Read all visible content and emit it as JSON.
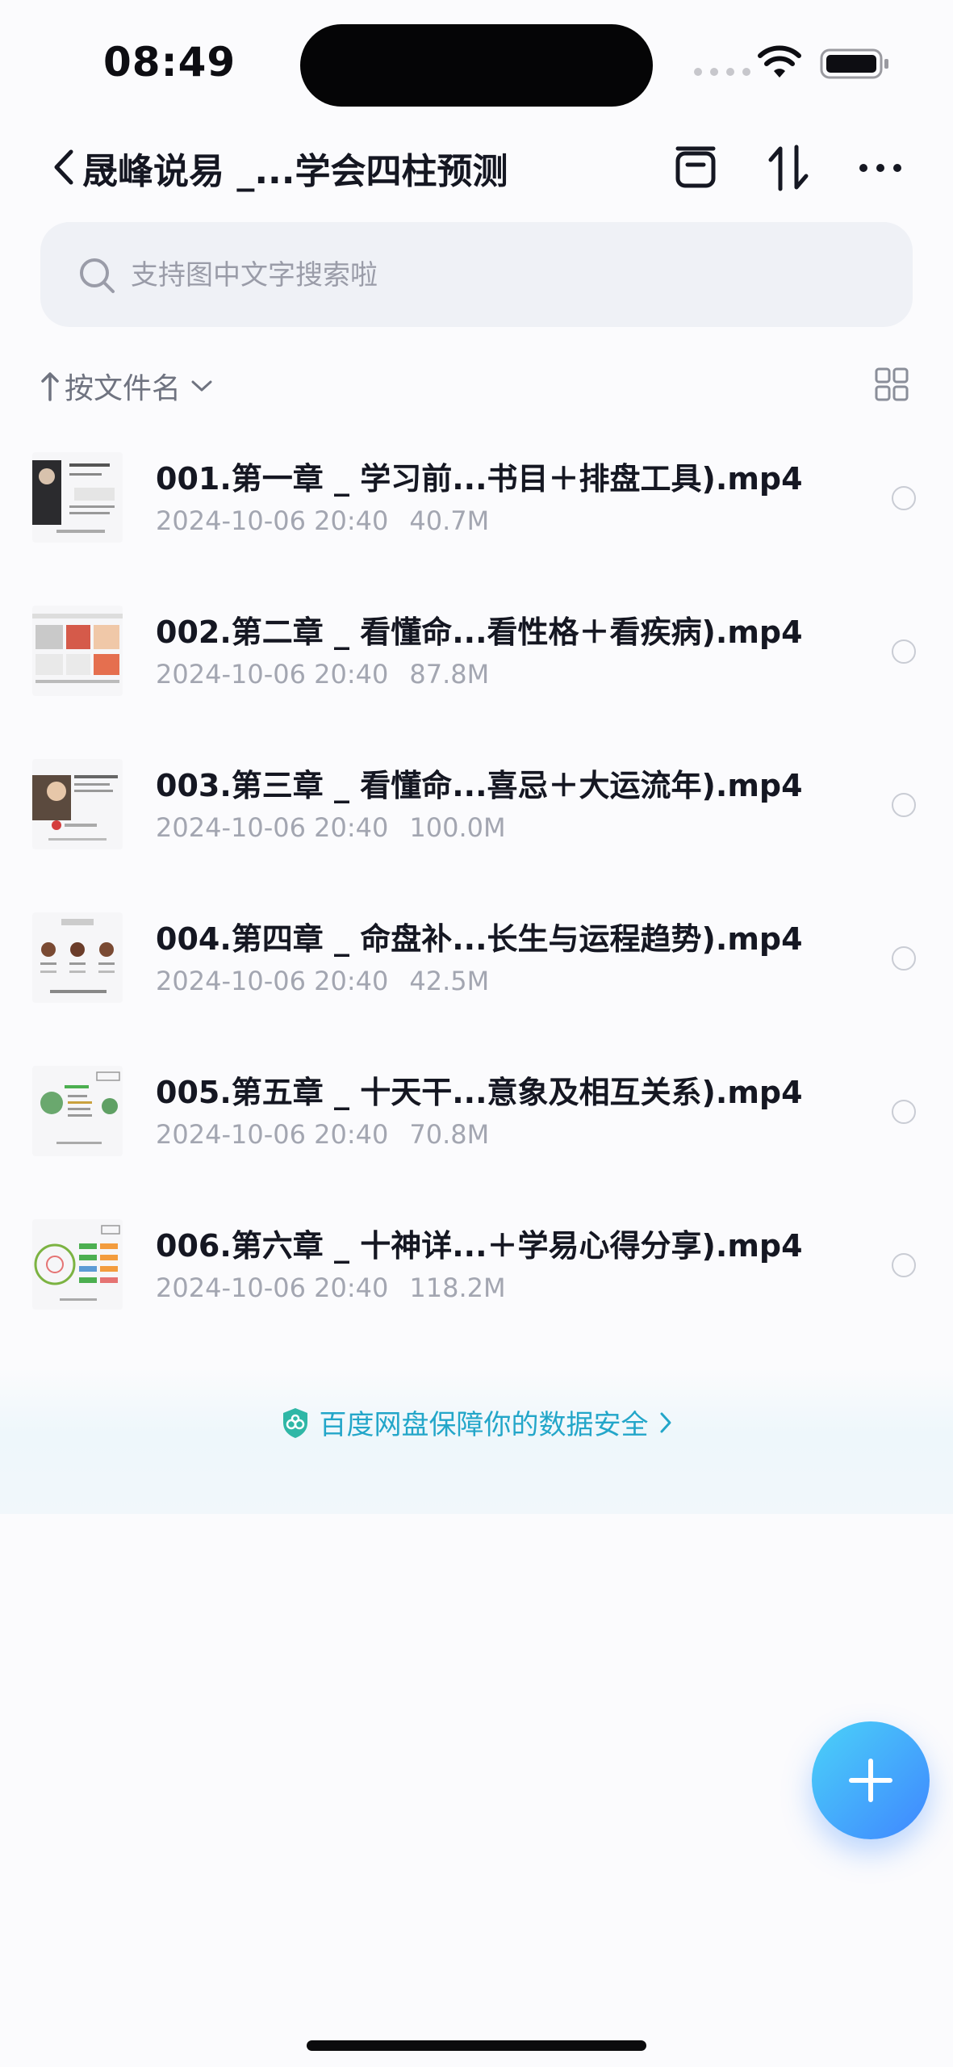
{
  "status_bar": {
    "time": "08:49"
  },
  "header": {
    "title": "晟峰说易 _...学会四柱预测"
  },
  "search": {
    "placeholder": "支持图中文字搜索啦"
  },
  "sort": {
    "label": "按文件名"
  },
  "files": [
    {
      "name": "001.第一章 _ 学习前...书目＋排盘工具).mp4",
      "date": "2024-10-06 20:40",
      "size": "40.7M"
    },
    {
      "name": "002.第二章 _ 看懂命...看性格＋看疾病).mp4",
      "date": "2024-10-06 20:40",
      "size": "87.8M"
    },
    {
      "name": "003.第三章 _ 看懂命...喜忌＋大运流年).mp4",
      "date": "2024-10-06 20:40",
      "size": "100.0M"
    },
    {
      "name": "004.第四章 _ 命盘补...长生与运程趋势).mp4",
      "date": "2024-10-06 20:40",
      "size": "42.5M"
    },
    {
      "name": "005.第五章 _ 十天干...意象及相互关系).mp4",
      "date": "2024-10-06 20:40",
      "size": "70.8M"
    },
    {
      "name": "006.第六章 _ 十神详...＋学易心得分享).mp4",
      "date": "2024-10-06 20:40",
      "size": "118.2M"
    }
  ],
  "banner": {
    "text": "百度网盘保障你的数据安全"
  },
  "colors": {
    "accent": "#23a6c9",
    "fab_start": "#4bd2f8",
    "fab_end": "#3f86ff"
  }
}
